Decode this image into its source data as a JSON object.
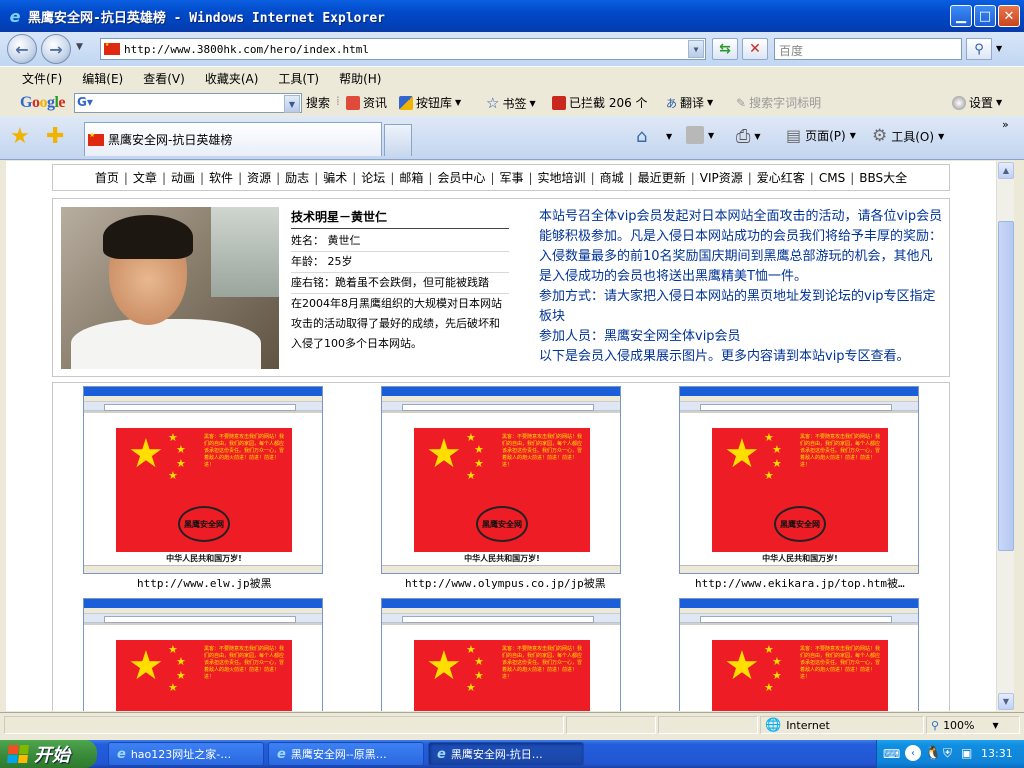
{
  "window": {
    "title": "黑鹰安全网-抗日英雄榜 - Windows Internet Explorer"
  },
  "address": {
    "url": "http://www.3800hk.com/hero/index.html"
  },
  "search": {
    "placeholder": "百度"
  },
  "menu": [
    "文件(F)",
    "编辑(E)",
    "查看(V)",
    "收藏夹(A)",
    "工具(T)",
    "帮助(H)"
  ],
  "google_toolbar": {
    "logo": "Google",
    "search_label": "搜索",
    "news": "资讯",
    "buttons": "按钮库",
    "bookmarks": "书签",
    "blocked": "已拦截 206 个",
    "translate": "翻译",
    "highlight": "搜索字词标明",
    "settings": "设置"
  },
  "tab": {
    "title": "黑鹰安全网-抗日英雄榜"
  },
  "commands": {
    "page": "页面(P)",
    "tools": "工具(O)"
  },
  "site_nav": [
    "首页",
    "文章",
    "动画",
    "软件",
    "资源",
    "励志",
    "骗术",
    "论坛",
    "邮箱",
    "会员中心",
    "军事",
    "实地培训",
    "商城",
    "最近更新",
    "VIP资源",
    "爱心红客",
    "CMS",
    "BBS大全"
  ],
  "profile": {
    "heading": "技术明星－黄世仁",
    "name": "姓名： 黄世仁",
    "age": "年龄： 25岁",
    "motto": "座右铭：跪着虽不会跌倒，但可能被践踏",
    "bio": "在2004年8月黑鹰组织的大规模对日本网站攻击的活动取得了最好的成绩，先后破坏和入侵了100多个日本网站。"
  },
  "notice": {
    "p1": "本站号召全体vip会员发起对日本网站全面攻击的活动，请各位vip会员能够积极参加。凡是入侵日本网站成功的会员我们将给予丰厚的奖励：入侵数量最多的前10名奖励国庆期间到黑鹰总部游玩的机会，其他凡是入侵成功的会员也将送出黑鹰精美T恤一件。",
    "p2": "参加方式：请大家把入侵日本网站的黑页地址发到论坛的vip专区指定板块",
    "p3": "参加人员：黑鹰安全网全体vip会员",
    "p4": "以下是会员入侵成果展示图片。更多内容请到本站vip专区查看。"
  },
  "gallery": {
    "flag_caption": "中华人民共和国万岁!",
    "emblem_text": "黑鹰安全网",
    "items": [
      {
        "caption": "http://www.elw.jp被黑"
      },
      {
        "caption": "http://www.olympus.co.jp/jp被黑"
      },
      {
        "caption": "http://www.ekikara.jp/top.htm被…"
      },
      {
        "caption": ""
      },
      {
        "caption": ""
      },
      {
        "caption": ""
      }
    ]
  },
  "status": {
    "zone": "Internet",
    "zoom": "100%"
  },
  "taskbar": {
    "start": "开始",
    "tasks": [
      "hao123网址之家-…",
      "黑鹰安全网--原黑…",
      "黑鹰安全网-抗日…"
    ],
    "clock": "13:31"
  },
  "colors": {
    "title_blue": "#0049c8",
    "notice_blue": "#003399",
    "flag_red": "#ee1c25",
    "star_yellow": "#ffde00",
    "taskbar_blue": "#245edb"
  }
}
